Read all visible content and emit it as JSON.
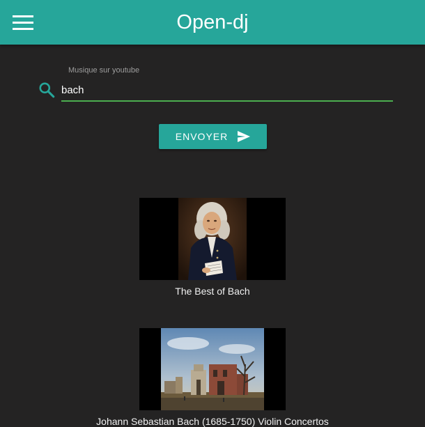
{
  "app": {
    "title": "Open-dj"
  },
  "header": {
    "menu_icon": "hamburger-menu-icon"
  },
  "search": {
    "label": "Musique sur youtube",
    "value": "bach",
    "icon": "search-icon",
    "submit_label": "ENVOYER",
    "submit_icon": "send-icon"
  },
  "results": [
    {
      "title": "The Best of Bach",
      "thumbnail": "portrait-painting-thumbnail"
    },
    {
      "title": "Johann Sebastian Bach (1685-1750) Violin Concertos",
      "thumbnail": "landscape-painting-thumbnail"
    }
  ],
  "colors": {
    "primary": "#26a69a",
    "background": "#242323",
    "input_underline": "#4caf50"
  }
}
